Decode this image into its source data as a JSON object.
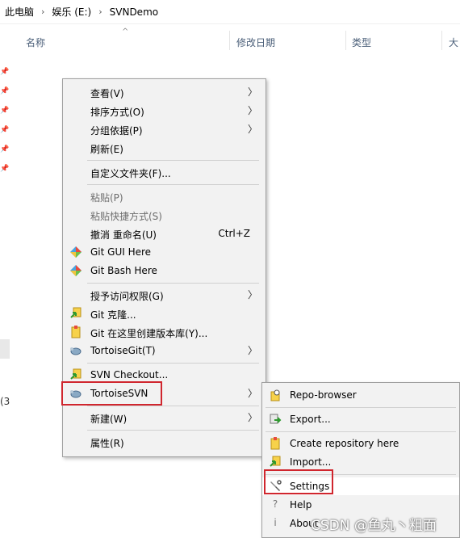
{
  "breadcrumb": [
    "此电脑",
    "娱乐 (E:)",
    "SVNDemo"
  ],
  "columns": {
    "name": "名称",
    "modified": "修改日期",
    "type": "类型",
    "size": "大"
  },
  "left_fragment": "(3",
  "main_menu": {
    "view": "查看(V)",
    "sort": "排序方式(O)",
    "group": "分组依据(P)",
    "refresh": "刷新(E)",
    "customize": "自定义文件夹(F)...",
    "paste": "粘贴(P)",
    "paste_shortcut": "粘贴快捷方式(S)",
    "undo": "撤消 重命名(U)",
    "undo_shortcut": "Ctrl+Z",
    "git_gui": "Git GUI Here",
    "git_bash": "Git Bash Here",
    "grant_access": "授予访问权限(G)",
    "git_clone": "Git 克隆...",
    "git_create": "Git 在这里创建版本库(Y)...",
    "tortoisegit": "TortoiseGit(T)",
    "svn_checkout": "SVN Checkout...",
    "tortoisesvn": "TortoiseSVN",
    "new": "新建(W)",
    "properties": "属性(R)"
  },
  "sub_menu": {
    "repo_browser": "Repo-browser",
    "export": "Export...",
    "create_repo": "Create repository here",
    "import": "Import...",
    "settings": "Settings",
    "help": "Help",
    "about": "About"
  },
  "watermark": "CSDN @鱼丸丶粗面",
  "colors": {
    "highlight_box": "#d0262e",
    "menu_bg": "#f2f2f2",
    "disabled_text": "#6d6d6d"
  }
}
